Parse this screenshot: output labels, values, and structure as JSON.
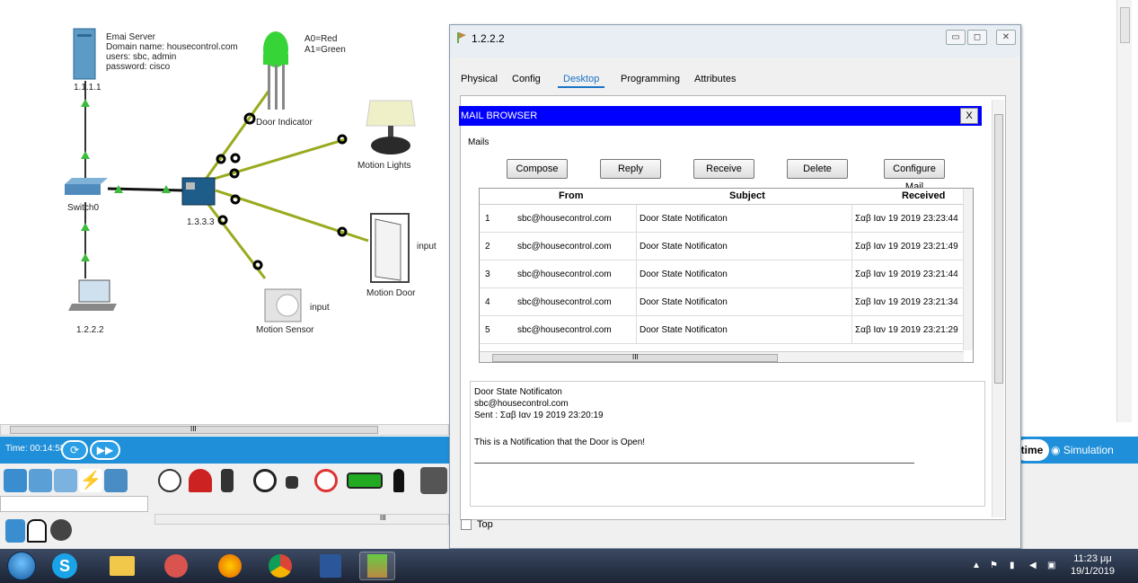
{
  "workspace": {
    "devices": {
      "server_ip": "1.1.1.1",
      "server_title": "Emai Server",
      "server_domain": "Domain name: housecontrol.com",
      "server_users": "users: sbc, admin",
      "server_password": "password: cisco",
      "led_a0": "A0=Red",
      "led_a1": "A1=Green",
      "door_indicator": "Door Indicator",
      "motion_lights": "Motion Lights",
      "switch": "Switch0",
      "mcu_ip": "1.3.3.3",
      "door_input": "input",
      "motion_door": "Motion Door",
      "sensor_input": "input",
      "motion_sensor": "Motion Sensor",
      "laptop_ip": "1.2.2.2"
    },
    "hscroll_grip": "III"
  },
  "timebar": {
    "time": "Time: 00:14:58",
    "realtime_label": "time",
    "simulation_label": "Simulation"
  },
  "window": {
    "title": "1.2.2.2",
    "tabs": [
      "Physical",
      "Config",
      "Desktop",
      "Programming",
      "Attributes"
    ],
    "active_tab": "Desktop",
    "mail_browser": {
      "header": "MAIL BROWSER",
      "close": "X",
      "mails_label": "Mails",
      "buttons": [
        "Compose",
        "Reply",
        "Receive",
        "Delete",
        "Configure Mail"
      ],
      "columns": [
        "From",
        "Subject",
        "Received"
      ],
      "rows": [
        {
          "num": "1",
          "from": "sbc@housecontrol.com",
          "subject": "Door State Notificaton",
          "received": "Σαβ Ιαν 19 2019 23:23:44"
        },
        {
          "num": "2",
          "from": "sbc@housecontrol.com",
          "subject": "Door State Notificaton",
          "received": "Σαβ Ιαν 19 2019 23:21:49"
        },
        {
          "num": "3",
          "from": "sbc@housecontrol.com",
          "subject": "Door State Notificaton",
          "received": "Σαβ Ιαν 19 2019 23:21:44"
        },
        {
          "num": "4",
          "from": "sbc@housecontrol.com",
          "subject": "Door State Notificaton",
          "received": "Σαβ Ιαν 19 2019 23:21:34"
        },
        {
          "num": "5",
          "from": "sbc@housecontrol.com",
          "subject": "Door State Notificaton",
          "received": "Σαβ Ιαν 19 2019 23:21:29"
        }
      ],
      "table_hscroll_grip": "III",
      "preview": {
        "subject": "Door State Notificaton",
        "from": "sbc@housecontrol.com",
        "sent": "Sent : Σαβ Ιαν 19 2019 23:20:19",
        "body": "This is a Notification that the Door is Open!"
      }
    },
    "top_checkbox_label": "Top"
  },
  "taskbar": {
    "time": "11:23 μμ",
    "date": "19/1/2019"
  },
  "palette": {
    "hscroll_grip": "III"
  },
  "colors": {
    "mail_header": "#0000ff",
    "timebar": "#1e8fd8",
    "link": "#9aaa1e",
    "active_tab": "#1a73c4"
  }
}
